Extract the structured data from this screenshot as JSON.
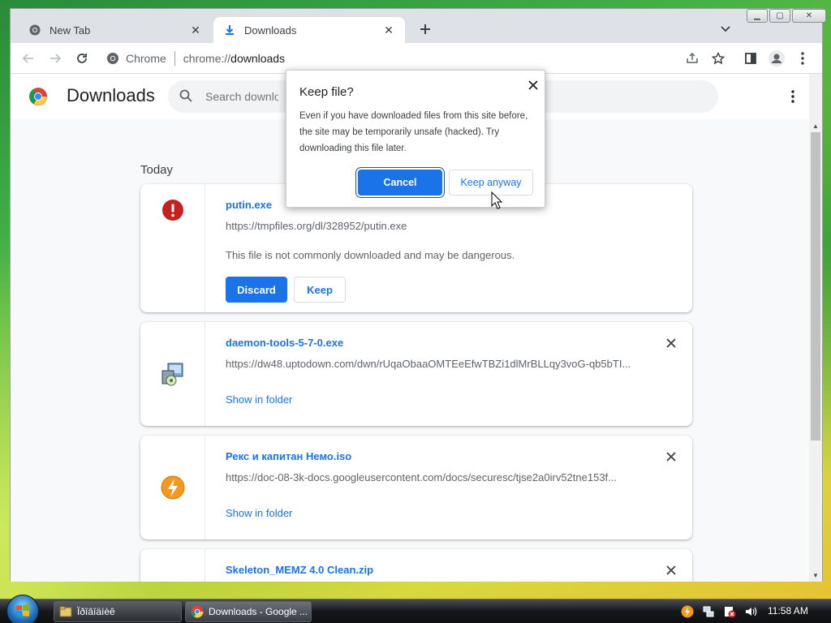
{
  "browser": {
    "tabs": [
      {
        "title": "New Tab",
        "icon": "chrome-icon",
        "active": false
      },
      {
        "title": "Downloads",
        "icon": "download-icon",
        "active": true
      }
    ],
    "omnibox": {
      "site_label": "Chrome",
      "url_scheme": "chrome://",
      "url_path": "downloads"
    }
  },
  "page": {
    "title": "Downloads",
    "search_placeholder": "Search downloads",
    "section_label": "Today",
    "downloads": [
      {
        "name": "putin.exe",
        "url": "https://tmpfiles.org/dl/328952/putin.exe",
        "warning": "This file is not commonly downloaded and may be dangerous.",
        "discard_label": "Discard",
        "keep_label": "Keep",
        "icon": "danger-icon"
      },
      {
        "name": "daemon-tools-5-7-0.exe",
        "url": "https://dw48.uptodown.com/dwn/rUqaObaaOMTEeEfwTBZi1dlMrBLLqy3voG-qb5bTI...",
        "action": "Show in folder",
        "icon": "installer-icon"
      },
      {
        "name": "Рекс и капитан Немо.iso",
        "url": "https://doc-08-3k-docs.googleusercontent.com/docs/securesc/tjse2a0irv52tne153f...",
        "action": "Show in folder",
        "icon": "daemon-tools-icon"
      },
      {
        "name": "Skeleton_MEMZ 4.0 Clean.zip",
        "icon": "zip-icon"
      }
    ]
  },
  "dialog": {
    "title": "Keep file?",
    "body": "Even if you have downloaded files from this site before, the site may be temporarily unsafe (hacked). Try downloading this file later.",
    "cancel_label": "Cancel",
    "keep_anyway_label": "Keep anyway"
  },
  "taskbar": {
    "buttons": [
      {
        "label": "Ïðîâîäíèê",
        "icon": "explorer-icon"
      },
      {
        "label": "Downloads - Google ...",
        "icon": "chrome-icon"
      }
    ],
    "clock": "11:58 AM"
  },
  "colors": {
    "accent": "#1a73e8",
    "danger": "#c5221f"
  }
}
